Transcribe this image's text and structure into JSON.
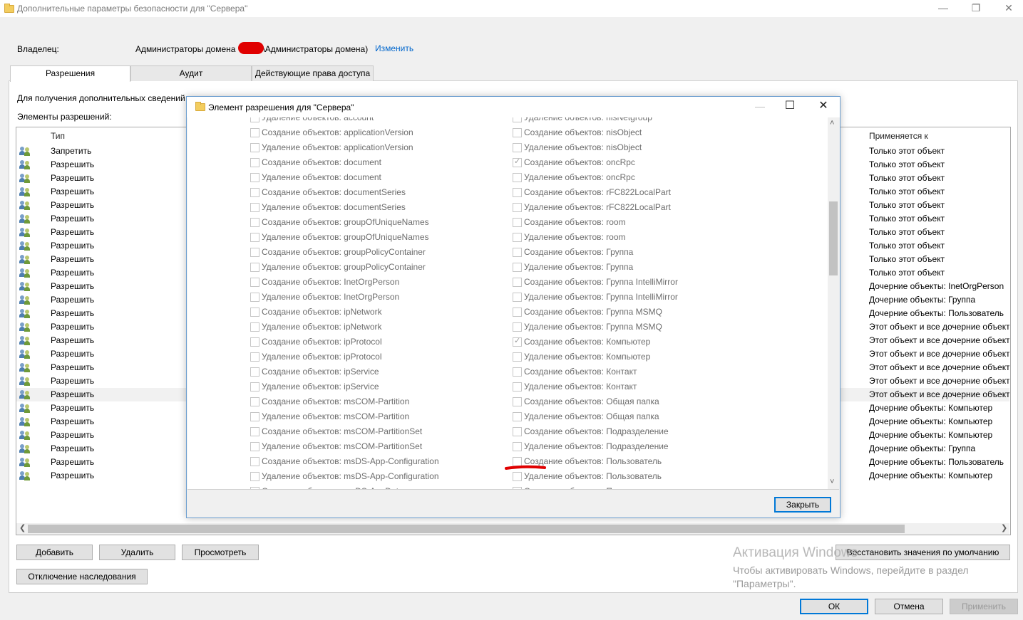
{
  "window": {
    "title": "Дополнительные параметры безопасности  для \"Сервера\"",
    "minimize": "—",
    "restore": "❐",
    "close": "✕"
  },
  "owner": {
    "label": "Владелец:",
    "value": "Администраторы домена) ",
    "value_prefix": "Администраторы домена",
    "value_suffix": "\\Администраторы домена)",
    "change_link": "Изменить"
  },
  "tabs": [
    {
      "label": "Разрешения",
      "active": true
    },
    {
      "label": "Аудит",
      "active": false
    },
    {
      "label": "Действующие права доступа",
      "active": false
    }
  ],
  "info_text": "Для получения дополнительных сведений ",
  "entries_label": "Элементы разрешений:",
  "columns": {
    "type": "Тип",
    "applies_to": "Применяется к"
  },
  "permission_rows": [
    {
      "type": "Запретить",
      "applies": "Только этот объект"
    },
    {
      "type": "Разрешить",
      "applies": "Только этот объект"
    },
    {
      "type": "Разрешить",
      "applies": "Только этот объект"
    },
    {
      "type": "Разрешить",
      "applies": "Только этот объект"
    },
    {
      "type": "Разрешить",
      "applies": "Только этот объект"
    },
    {
      "type": "Разрешить",
      "applies": "Только этот объект"
    },
    {
      "type": "Разрешить",
      "applies": "Только этот объект"
    },
    {
      "type": "Разрешить",
      "applies": "Только этот объект"
    },
    {
      "type": "Разрешить",
      "applies": "Только этот объект"
    },
    {
      "type": "Разрешить",
      "applies": "Только этот объект"
    },
    {
      "type": "Разрешить",
      "applies": "Дочерние объекты: InetOrgPerson"
    },
    {
      "type": "Разрешить",
      "applies": "Дочерние объекты: Группа"
    },
    {
      "type": "Разрешить",
      "applies": "Дочерние объекты: Пользователь"
    },
    {
      "type": "Разрешить",
      "applies": "Этот объект и все дочерние объекты"
    },
    {
      "type": "Разрешить",
      "applies": "Этот объект и все дочерние объекты"
    },
    {
      "type": "Разрешить",
      "applies": "Этот объект и все дочерние объекты"
    },
    {
      "type": "Разрешить",
      "applies": "Этот объект и все дочерние объекты"
    },
    {
      "type": "Разрешить",
      "applies": "Этот объект и все дочерние объекты"
    },
    {
      "type": "Разрешить",
      "applies": "Этот объект и все дочерние объекты",
      "selected": true
    },
    {
      "type": "Разрешить",
      "applies": "Дочерние объекты: Компьютер"
    },
    {
      "type": "Разрешить",
      "applies": "Дочерние объекты: Компьютер"
    },
    {
      "type": "Разрешить",
      "applies": "Дочерние объекты: Компьютер"
    },
    {
      "type": "Разрешить",
      "applies": "Дочерние объекты: Группа"
    },
    {
      "type": "Разрешить",
      "applies": "Дочерние объекты: Пользователь"
    },
    {
      "type": "Разрешить",
      "applies": "Дочерние объекты: Компьютер"
    }
  ],
  "buttons": {
    "add": "Добавить",
    "remove": "Удалить",
    "view": "Просмотреть",
    "disable_inheritance": "Отключение наследования",
    "restore_defaults": "Восстановить значения по умолчанию",
    "ok": "ОК",
    "cancel": "Отмена",
    "apply": "Применить"
  },
  "watermark": {
    "line1": "Активация Windows",
    "line2": "Чтобы активировать Windows, перейдите в раздел \"Параметры\"."
  },
  "dialog": {
    "title": "Элемент разрешения для \"Сервера\"",
    "minimize": "—",
    "maximize": "☐",
    "close": "✕",
    "close_button": "Закрыть",
    "left_column": [
      {
        "label": "Удаление объектов: account",
        "checked": false
      },
      {
        "label": "Создание объектов: applicationVersion",
        "checked": false
      },
      {
        "label": "Удаление объектов: applicationVersion",
        "checked": false
      },
      {
        "label": "Создание объектов: document",
        "checked": false
      },
      {
        "label": "Удаление объектов: document",
        "checked": false
      },
      {
        "label": "Создание объектов: documentSeries",
        "checked": false
      },
      {
        "label": "Удаление объектов: documentSeries",
        "checked": false
      },
      {
        "label": "Создание объектов: groupOfUniqueNames",
        "checked": false
      },
      {
        "label": "Удаление объектов: groupOfUniqueNames",
        "checked": false
      },
      {
        "label": "Создание объектов: groupPolicyContainer",
        "checked": false
      },
      {
        "label": "Удаление объектов: groupPolicyContainer",
        "checked": false
      },
      {
        "label": "Создание объектов: InetOrgPerson",
        "checked": false
      },
      {
        "label": "Удаление объектов: InetOrgPerson",
        "checked": false
      },
      {
        "label": "Создание объектов: ipNetwork",
        "checked": false
      },
      {
        "label": "Удаление объектов: ipNetwork",
        "checked": false
      },
      {
        "label": "Создание объектов: ipProtocol",
        "checked": false
      },
      {
        "label": "Удаление объектов: ipProtocol",
        "checked": false
      },
      {
        "label": "Создание объектов: ipService",
        "checked": false
      },
      {
        "label": "Удаление объектов: ipService",
        "checked": false
      },
      {
        "label": "Создание объектов: msCOM-Partition",
        "checked": false
      },
      {
        "label": "Удаление объектов: msCOM-Partition",
        "checked": false
      },
      {
        "label": "Создание объектов: msCOM-PartitionSet",
        "checked": false
      },
      {
        "label": "Удаление объектов: msCOM-PartitionSet",
        "checked": false
      },
      {
        "label": "Создание объектов: msDS-App-Configuration",
        "checked": false
      },
      {
        "label": "Удаление объектов: msDS-App-Configuration",
        "checked": false
      },
      {
        "label": "Создание объектов: msDS-AppData",
        "checked": false
      }
    ],
    "right_column": [
      {
        "label": "Удаление объектов: nisNetgroup",
        "checked": false
      },
      {
        "label": "Создание объектов: nisObject",
        "checked": false
      },
      {
        "label": "Удаление объектов: nisObject",
        "checked": false
      },
      {
        "label": "Создание объектов: oncRpc",
        "checked": true
      },
      {
        "label": "Удаление объектов: oncRpc",
        "checked": false
      },
      {
        "label": "Создание объектов: rFC822LocalPart",
        "checked": false
      },
      {
        "label": "Удаление объектов: rFC822LocalPart",
        "checked": false
      },
      {
        "label": "Создание объектов: room",
        "checked": false
      },
      {
        "label": "Удаление объектов: room",
        "checked": false
      },
      {
        "label": "Создание объектов: Группа",
        "checked": false
      },
      {
        "label": "Удаление объектов: Группа",
        "checked": false
      },
      {
        "label": "Создание объектов: Группа IntelliMirror",
        "checked": false
      },
      {
        "label": "Удаление объектов: Группа IntelliMirror",
        "checked": false
      },
      {
        "label": "Создание объектов: Группа MSMQ",
        "checked": false
      },
      {
        "label": "Удаление объектов: Группа MSMQ",
        "checked": false
      },
      {
        "label": "Создание объектов: Компьютер",
        "checked": true
      },
      {
        "label": "Удаление объектов: Компьютер",
        "checked": false
      },
      {
        "label": "Создание объектов: Контакт",
        "checked": false
      },
      {
        "label": "Удаление объектов: Контакт",
        "checked": false
      },
      {
        "label": "Создание объектов: Общая папка",
        "checked": false
      },
      {
        "label": "Удаление объектов: Общая папка",
        "checked": false
      },
      {
        "label": "Создание объектов: Подразделение",
        "checked": false
      },
      {
        "label": "Удаление объектов: Подразделение",
        "checked": false
      },
      {
        "label": "Создание объектов: Пользователь",
        "checked": false
      },
      {
        "label": "Удаление объектов: Пользователь",
        "checked": false
      },
      {
        "label": "Создание объектов: Принтер",
        "checked": false
      }
    ]
  }
}
